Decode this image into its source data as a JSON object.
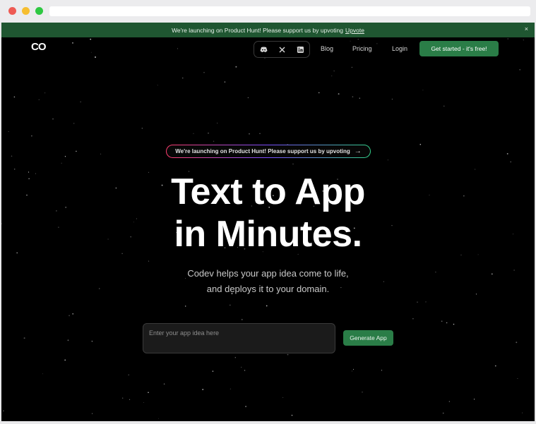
{
  "browser": {
    "address": ""
  },
  "banner": {
    "text": "We're launching on Product Hunt! Please support us by upvoting",
    "link": "Upvote",
    "close": "×"
  },
  "header": {
    "logo": "CO",
    "social_icons": [
      "discord-icon",
      "x-icon",
      "linkedin-icon"
    ],
    "nav": {
      "blog": "Blog",
      "pricing": "Pricing",
      "login": "Login"
    },
    "cta": "Get started - it's free!"
  },
  "hero": {
    "pill_text": "We're launching on Product Hunt! Please support us by upvoting",
    "pill_arrow": "→",
    "headline_line1": "Text to App",
    "headline_line2": "in Minutes.",
    "sub_line1": "Codev helps your app idea come to life,",
    "sub_line2": "and deploys it to your domain."
  },
  "form": {
    "placeholder": "Enter your app idea here",
    "value": "",
    "button": "Generate App"
  },
  "colors": {
    "banner_bg": "#1f5631",
    "accent_green": "#2a7d47",
    "page_bg": "#000000"
  }
}
